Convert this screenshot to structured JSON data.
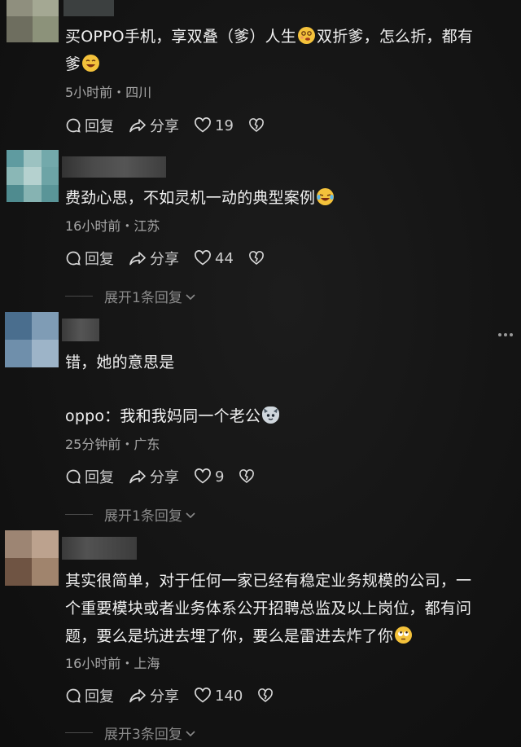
{
  "comments": [
    {
      "text_parts": [
        "买OPPO手机，享双叠（爹）人生",
        "双折爹，怎么折，都有",
        "爹"
      ],
      "meta": "5小时前・四川",
      "reply_label": "回复",
      "share_label": "分享",
      "likes": "19",
      "avatar_colors": [
        "#8c8c7a",
        "#9aa08a",
        "#6f6f60",
        "#8a9078"
      ]
    },
    {
      "text": "费劲心思，不如灵机一动的典型案例",
      "meta": "16小时前・江苏",
      "reply_label": "回复",
      "share_label": "分享",
      "likes": "44",
      "expand": "展开1条回复",
      "avatar_colors": [
        "#6aa2a6",
        "#9fc2c0",
        "#8cb6b4",
        "#5d9497"
      ]
    },
    {
      "line1": "错，她的意思是",
      "line2": "oppo：我和我妈同一个老公",
      "meta": "25分钟前・广东",
      "reply_label": "回复",
      "share_label": "分享",
      "likes": "9",
      "expand": "展开1条回复",
      "avatar_colors": [
        "#4f6f8c",
        "#7e9bb4",
        "#6c8aa6",
        "#9ab2c6"
      ]
    },
    {
      "lines": [
        "其实很简单，对于任何一家已经有稳定业务规模的公司，一",
        "个重要模块或者业务体系公开招聘总监及以上岗位，都有问",
        "题，要么是坑进去埋了你，要么是雷进去炸了你"
      ],
      "meta": "16小时前・上海",
      "reply_label": "回复",
      "share_label": "分享",
      "likes": "140",
      "expand": "展开3条回复",
      "avatar_colors": [
        "#9a8270",
        "#b9a08c",
        "#7b5f4c",
        "#a58a72"
      ]
    }
  ],
  "colors": {
    "background": "#141414",
    "text": "#f0f0f0",
    "meta": "#a7a7a7",
    "expand": "#8a8a8a"
  },
  "icons": [
    "reply-icon",
    "share-icon",
    "heart-icon",
    "dislike-icon",
    "more-icon"
  ]
}
